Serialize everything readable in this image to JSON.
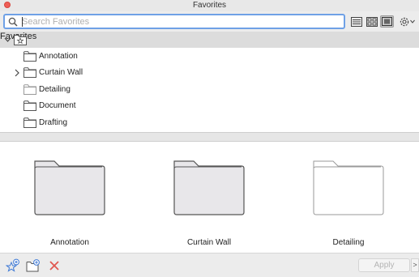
{
  "window": {
    "title": "Favorites"
  },
  "search": {
    "placeholder": "Search Favorites",
    "value": ""
  },
  "view_buttons": [
    {
      "icon": "list-view-icon"
    },
    {
      "icon": "columns-view-icon"
    },
    {
      "icon": "preview-view-icon",
      "active": true
    },
    {
      "icon": "gear-icon"
    }
  ],
  "tree": {
    "root_label": "Favorites",
    "items": [
      {
        "label": "Annotation",
        "expandable": false
      },
      {
        "label": "Curtain Wall",
        "expandable": true
      },
      {
        "label": "Detailing",
        "expandable": false
      },
      {
        "label": "Document",
        "expandable": false
      },
      {
        "label": "Drafting",
        "expandable": false
      }
    ]
  },
  "grid": {
    "tiles": [
      {
        "label": "Annotation",
        "style": "filled"
      },
      {
        "label": "Curtain Wall",
        "style": "filled"
      },
      {
        "label": "Detailing",
        "style": "outline"
      }
    ]
  },
  "bottom": {
    "apply_label": "Apply",
    "more_label": ">",
    "icons": [
      "new-favorite-icon",
      "new-folder-icon",
      "delete-icon"
    ]
  },
  "colors": {
    "accent": "#6fa1e6",
    "delete": "#e0574f",
    "header_bg": "#dcdcdc"
  }
}
